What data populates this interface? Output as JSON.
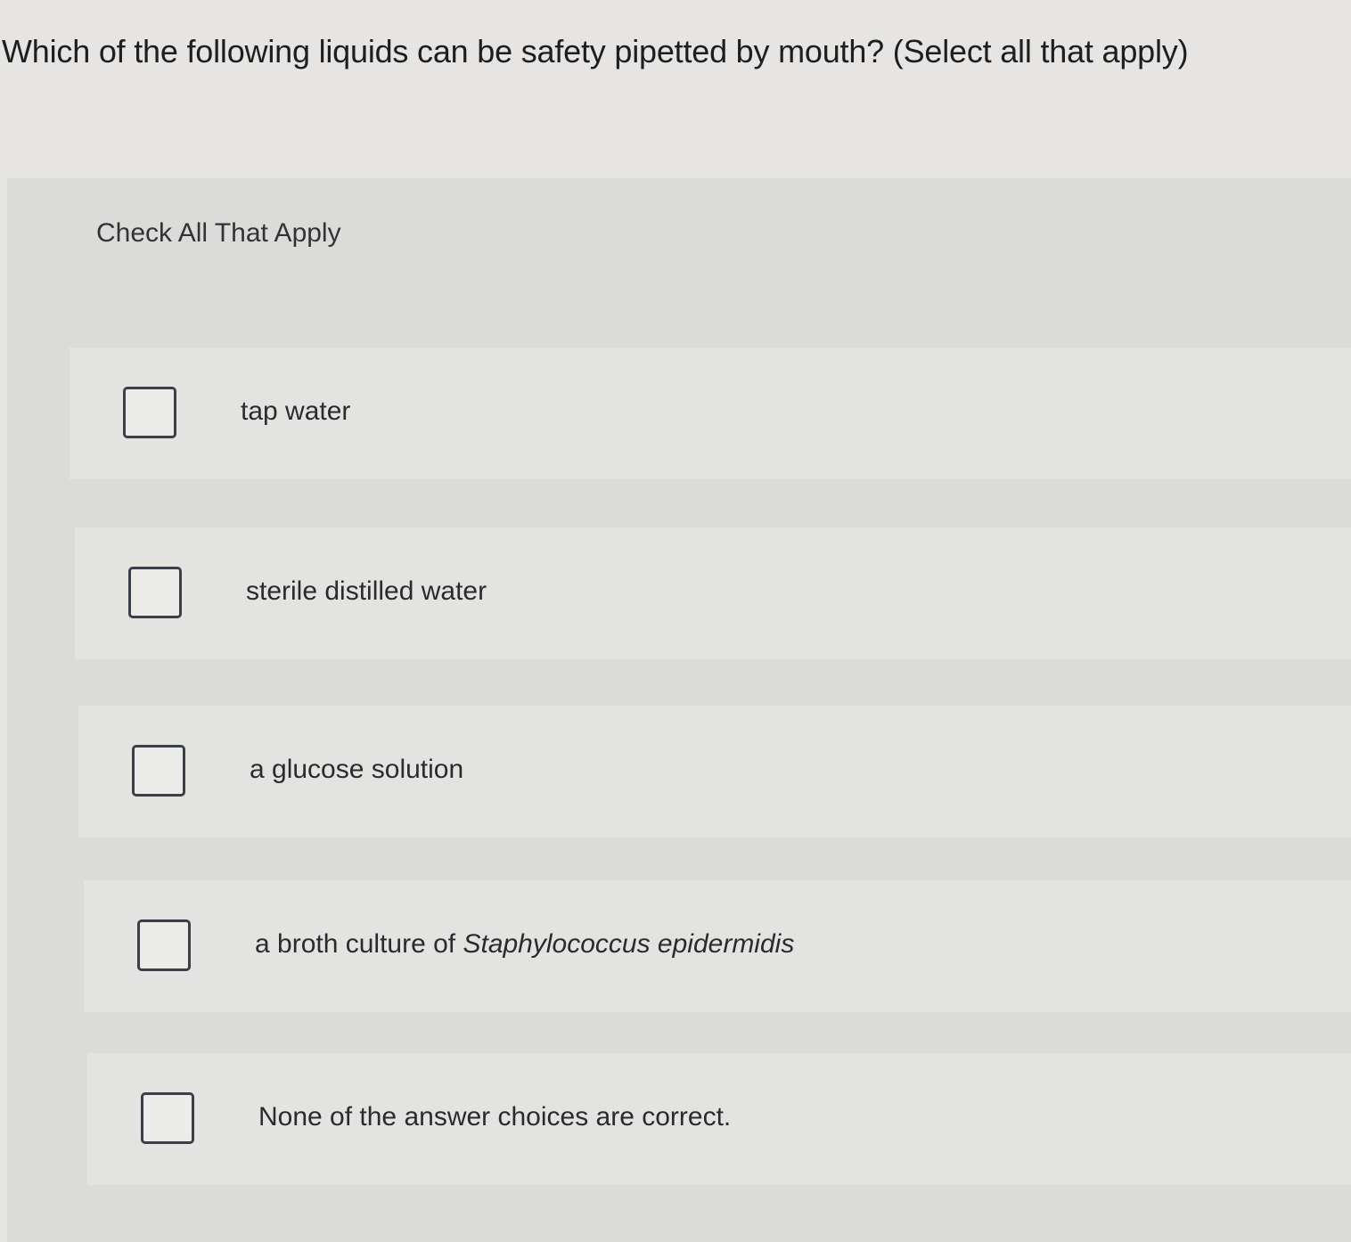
{
  "question": {
    "text": "Which of the following liquids can be safety pipetted by mouth? (Select all that apply)"
  },
  "panel": {
    "header": "Check All That Apply"
  },
  "options": [
    {
      "label": "tap water",
      "label_italic": "",
      "checked": false
    },
    {
      "label": "sterile distilled water",
      "label_italic": "",
      "checked": false
    },
    {
      "label": "a glucose solution",
      "label_italic": "",
      "checked": false
    },
    {
      "label": "a broth culture of ",
      "label_italic": "Staphylococcus epidermidis",
      "checked": false
    },
    {
      "label": "None of the answer choices are correct.",
      "label_italic": "",
      "checked": false
    }
  ],
  "colors": {
    "page_background": "#e6e5e4",
    "panel_background": "#dbdbda",
    "option_background": "#e3e3e2",
    "checkbox_border": "#3a3f48",
    "text": "#2b2b2b"
  }
}
